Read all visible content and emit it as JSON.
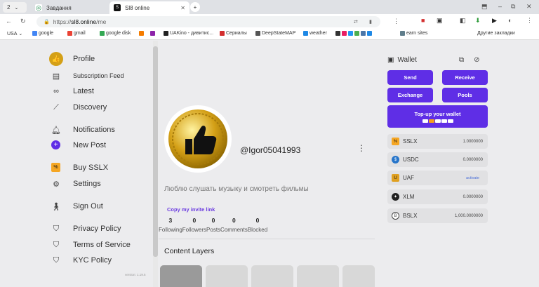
{
  "browser": {
    "tab_count": "2",
    "tabs": [
      {
        "title": "Завдання"
      },
      {
        "title": "Sl8 online"
      }
    ],
    "url_scheme": "https://",
    "url_host": "sl8.online",
    "url_path": "/me",
    "bookmarks": [
      {
        "label": "USA",
        "color": "#888888"
      },
      {
        "label": "google",
        "color": "#4285f4"
      },
      {
        "label": "gmail",
        "color": "#ea4335"
      },
      {
        "label": "google disk",
        "color": "#34a853"
      },
      {
        "label": "",
        "color": "#f57c00"
      },
      {
        "label": "",
        "color": "#8e24aa"
      },
      {
        "label": "UAKino - дивитис...",
        "color": "#222222"
      },
      {
        "label": "Сериалы",
        "color": "#d32f2f"
      },
      {
        "label": "DeepStateMAP",
        "color": "#555555"
      },
      {
        "label": "weather",
        "color": "#1e88e5"
      },
      {
        "label": "earn sites",
        "color": "#607d8b"
      }
    ],
    "other_bookmarks": "Другие закладки"
  },
  "sidebar": {
    "items": [
      {
        "label": "Profile",
        "icon": "thumbs-up-avatar-icon"
      },
      {
        "label": "Subscription Feed",
        "icon": "feed-icon"
      },
      {
        "label": "Latest",
        "icon": "infinity-icon"
      },
      {
        "label": "Discovery",
        "icon": "telescope-icon"
      },
      {
        "label": "Notifications",
        "icon": "bell-icon"
      },
      {
        "label": "New Post",
        "icon": "plus-circle-icon"
      },
      {
        "label": "Buy SSLX",
        "icon": "sslx-icon"
      },
      {
        "label": "Settings",
        "icon": "gear-icon"
      },
      {
        "label": "Sign Out",
        "icon": "walking-person-icon"
      },
      {
        "label": "Privacy Policy",
        "icon": "shield-check-icon"
      },
      {
        "label": "Terms of Service",
        "icon": "shield-check-icon"
      },
      {
        "label": "KYC Policy",
        "icon": "shield-check-icon"
      }
    ],
    "version": "version: 1.19.5"
  },
  "profile": {
    "username": "@Igor05041993",
    "bio": "Люблю слушать музыку и смотреть фильмы",
    "invite_link": "Copy my invite link",
    "stats": [
      {
        "value": "3",
        "label": "Following"
      },
      {
        "value": "0",
        "label": "Followers"
      },
      {
        "value": "0",
        "label": "Posts"
      },
      {
        "value": "0",
        "label": "Comments"
      },
      {
        "value": "0",
        "label": "Blocked"
      }
    ],
    "content_layers_title": "Content Layers"
  },
  "wallet": {
    "title": "Wallet",
    "buttons": {
      "send": "Send",
      "receive": "Receive",
      "exchange": "Exchange",
      "pools": "Pools"
    },
    "topup": "Top-up your wallet",
    "assets": [
      {
        "symbol": "SSLX",
        "balance": "1.0000000",
        "color": "#f5a623"
      },
      {
        "symbol": "USDC",
        "balance": "0.0000000",
        "color": "#2775ca"
      },
      {
        "symbol": "UAF",
        "balance": "",
        "action": "activate",
        "color": "#e0a020"
      },
      {
        "symbol": "XLM",
        "balance": "0.0000000",
        "color": "#222222"
      },
      {
        "symbol": "BSLX",
        "balance": "1,000.0000000",
        "color": "#444444"
      }
    ],
    "accent": "#5f2ee6"
  }
}
